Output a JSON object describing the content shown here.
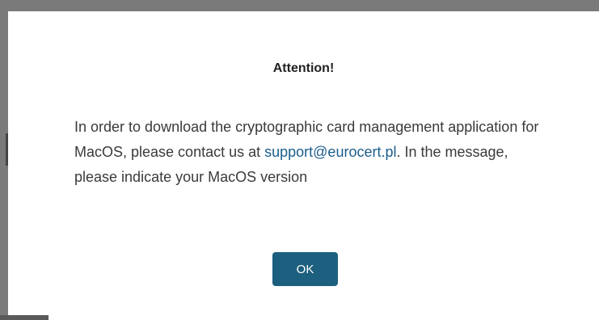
{
  "dialog": {
    "title": "Attention!",
    "message_part1": "In order to download the cryptographic card management application for MacOS, please contact us at ",
    "email_link": "support@eurocert.pl",
    "message_part2": ". In the message, please indicate your MacOS version",
    "ok_label": "OK"
  },
  "colors": {
    "link": "#1b5e8c",
    "button": "#1d5f7e",
    "text": "#3a3a3a"
  }
}
